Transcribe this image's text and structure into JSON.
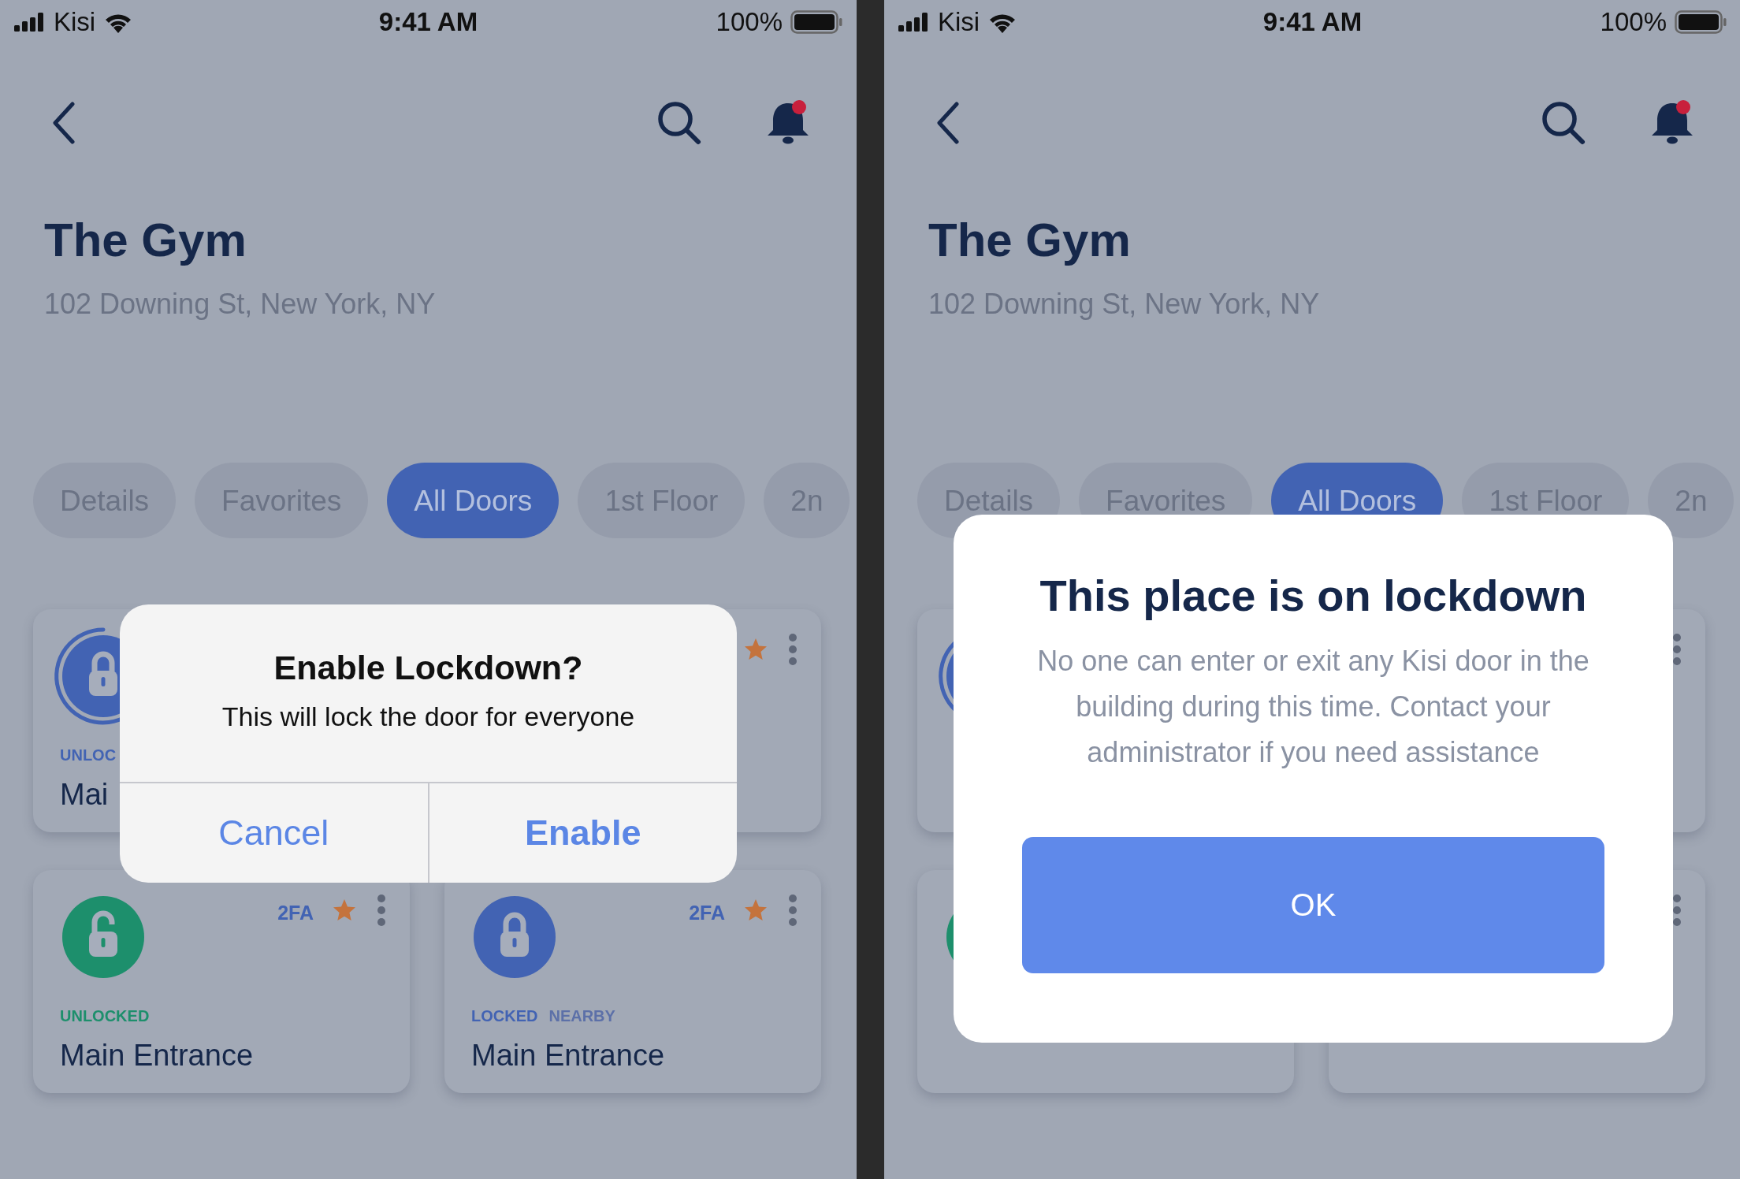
{
  "screens": [
    {
      "status_bar": {
        "carrier": "Kisi",
        "time": "9:41 AM",
        "battery": "100%"
      },
      "nav": {
        "has_notification": true
      },
      "title": "The Gym",
      "address": "102 Downing St, New York, NY",
      "tabs": [
        {
          "label": "Details",
          "selected": false
        },
        {
          "label": "Favorites",
          "selected": false
        },
        {
          "label": "All Doors",
          "selected": true
        },
        {
          "label": "1st Floor",
          "selected": false
        },
        {
          "label": "2n",
          "selected": false
        }
      ],
      "cards": [
        {
          "kind": "unlocking",
          "status": "UNLOC",
          "name": "Mai"
        },
        {
          "favorite": true,
          "menu": true
        },
        {
          "kind": "unlocked",
          "status": "UNLOCKED",
          "name": "Main Entrance",
          "two_fa": "2FA",
          "favorite": true,
          "menu": true
        },
        {
          "kind": "locked",
          "status": "LOCKED",
          "tag": "NEARBY",
          "name": "Main Entrance",
          "two_fa": "2FA",
          "favorite": true,
          "menu": true
        }
      ],
      "dialog": {
        "kind": "alert",
        "title": "Enable Lockdown?",
        "message": "This will lock the door for everyone",
        "buttons": [
          {
            "label": "Cancel",
            "primary": false
          },
          {
            "label": "Enable",
            "primary": true
          }
        ]
      }
    },
    {
      "status_bar": {
        "carrier": "Kisi",
        "time": "9:41 AM",
        "battery": "100%"
      },
      "nav": {
        "has_notification": true
      },
      "title": "The Gym",
      "address": "102 Downing St, New York, NY",
      "tabs": [
        {
          "label": "Details",
          "selected": false
        },
        {
          "label": "Favorites",
          "selected": false
        },
        {
          "label": "All Doors",
          "selected": true
        },
        {
          "label": "1st Floor",
          "selected": false
        },
        {
          "label": "2n",
          "selected": false
        }
      ],
      "cards": [
        {
          "kind": "unlocking"
        },
        {
          "menu": true
        },
        {
          "kind": "unlocked"
        },
        {
          "menu": true
        }
      ],
      "dialog": {
        "kind": "modal",
        "title": "This place is on lockdown",
        "message": "No one can enter or exit any Kisi door in the building during this time. Contact your administrator if you need assistance",
        "buttons": [
          {
            "label": "OK",
            "primary": true
          }
        ]
      }
    }
  ]
}
